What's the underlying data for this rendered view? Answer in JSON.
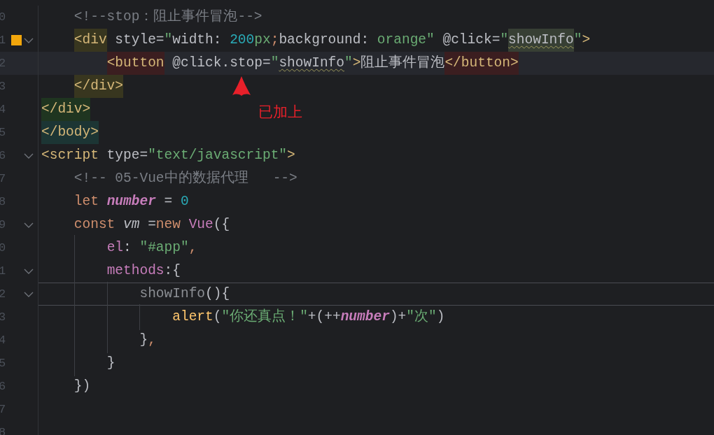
{
  "editor": {
    "lines": [
      {
        "number": "0",
        "tokens": [
          {
            "text": "    <!--stop：阻止事件冒泡-->",
            "kind": "comment"
          }
        ]
      },
      {
        "number": "1",
        "bookmark": true,
        "fold": true,
        "tokens": [
          {
            "text": "    <div",
            "kind": "tag",
            "color": "#38361f"
          },
          {
            "text": " style=",
            "kind": "plain"
          },
          {
            "text": "\"",
            "kind": "string"
          },
          {
            "text": "width: ",
            "kind": "plain"
          },
          {
            "text": "200",
            "kind": "number"
          },
          {
            "text": "px",
            "kind": "string"
          },
          {
            "text": ";",
            "kind": "keyword"
          },
          {
            "text": "background: ",
            "kind": "plain"
          },
          {
            "text": "orange\"",
            "kind": "string"
          },
          {
            "text": " @click=",
            "kind": "plain"
          },
          {
            "text": "\"",
            "kind": "string"
          },
          {
            "text": "showInfo",
            "kind": "plain",
            "color": "#373f34",
            "underline": true
          },
          {
            "text": "\"",
            "kind": "string"
          },
          {
            "text": ">",
            "kind": "tag"
          }
        ]
      },
      {
        "number": "2",
        "current": true,
        "tokens": [
          {
            "text": "        <button",
            "kind": "tag",
            "color": "#3b1e20"
          },
          {
            "text": " @click.stop=",
            "kind": "plain"
          },
          {
            "text": "\"",
            "kind": "string"
          },
          {
            "text": "showInfo",
            "kind": "plain",
            "underline": true
          },
          {
            "text": "\"",
            "kind": "string"
          },
          {
            "text": ">",
            "kind": "tag"
          },
          {
            "text": "阻止事件冒泡",
            "kind": "plain"
          },
          {
            "text": "</button>",
            "kind": "tag",
            "color": "#3b1e20"
          }
        ]
      },
      {
        "number": "3",
        "tokens": [
          {
            "text": "    </div>",
            "kind": "tag",
            "color": "#38361f"
          }
        ]
      },
      {
        "number": "4",
        "tokens": [
          {
            "text": "</div>",
            "kind": "tag",
            "color": "#1f3520"
          }
        ]
      },
      {
        "number": "5",
        "tokens": [
          {
            "text": "</body>",
            "kind": "tag",
            "color": "#1c3534"
          }
        ]
      },
      {
        "number": "6",
        "fold": true,
        "tokens": [
          {
            "text": "<script",
            "kind": "tag"
          },
          {
            "text": " type=",
            "kind": "plain"
          },
          {
            "text": "\"text/javascript\"",
            "kind": "string"
          },
          {
            "text": ">",
            "kind": "tag"
          }
        ]
      },
      {
        "number": "7",
        "tokens": [
          {
            "text": "    <!-- 05-Vue中的数据代理   -->",
            "kind": "comment"
          }
        ]
      },
      {
        "number": "8",
        "tokens": [
          {
            "text": "    let ",
            "kind": "keyword"
          },
          {
            "text": "number",
            "kind": "var"
          },
          {
            "text": " = ",
            "kind": "plain"
          },
          {
            "text": "0",
            "kind": "number"
          }
        ]
      },
      {
        "number": "9",
        "fold": true,
        "tokens": [
          {
            "text": "    const ",
            "kind": "keyword"
          },
          {
            "text": "vm",
            "kind": "local"
          },
          {
            "text": " =",
            "kind": "plain"
          },
          {
            "text": "new ",
            "kind": "keyword"
          },
          {
            "text": "Vue",
            "kind": "class"
          },
          {
            "text": "({",
            "kind": "plain"
          }
        ]
      },
      {
        "number": "0",
        "guides": true,
        "tokens": [
          {
            "text": "        el",
            "kind": "property"
          },
          {
            "text": ": ",
            "kind": "plain"
          },
          {
            "text": "\"#app\"",
            "kind": "string"
          },
          {
            "text": ",",
            "kind": "keyword"
          }
        ]
      },
      {
        "number": "1",
        "guides": true,
        "fold": true,
        "tokens": [
          {
            "text": "        methods",
            "kind": "property"
          },
          {
            "text": ":{",
            "kind": "plain"
          }
        ]
      },
      {
        "number": "2",
        "guides": true,
        "fold": true,
        "separator": true,
        "tokens": [
          {
            "text": "            showInfo",
            "kind": "unused"
          },
          {
            "text": "(){",
            "kind": "plain"
          }
        ]
      },
      {
        "number": "3",
        "guides": true,
        "tokens": [
          {
            "text": "                alert",
            "kind": "function"
          },
          {
            "text": "(",
            "kind": "plain"
          },
          {
            "text": "\"你还真点！\"",
            "kind": "string"
          },
          {
            "text": "+(++",
            "kind": "plain"
          },
          {
            "text": "number",
            "kind": "var"
          },
          {
            "text": ")+",
            "kind": "plain"
          },
          {
            "text": "\"次\"",
            "kind": "string"
          },
          {
            "text": ")",
            "kind": "plain"
          }
        ]
      },
      {
        "number": "4",
        "guides": true,
        "tokens": [
          {
            "text": "            }",
            "kind": "plain"
          },
          {
            "text": ",",
            "kind": "keyword"
          }
        ]
      },
      {
        "number": "5",
        "guides": true,
        "tokens": [
          {
            "text": "        }",
            "kind": "plain"
          }
        ]
      },
      {
        "number": "6",
        "tokens": [
          {
            "text": "    })",
            "kind": "plain"
          }
        ]
      },
      {
        "number": "7"
      },
      {
        "number": "8"
      }
    ]
  },
  "annotation": {
    "text": "已加上"
  }
}
